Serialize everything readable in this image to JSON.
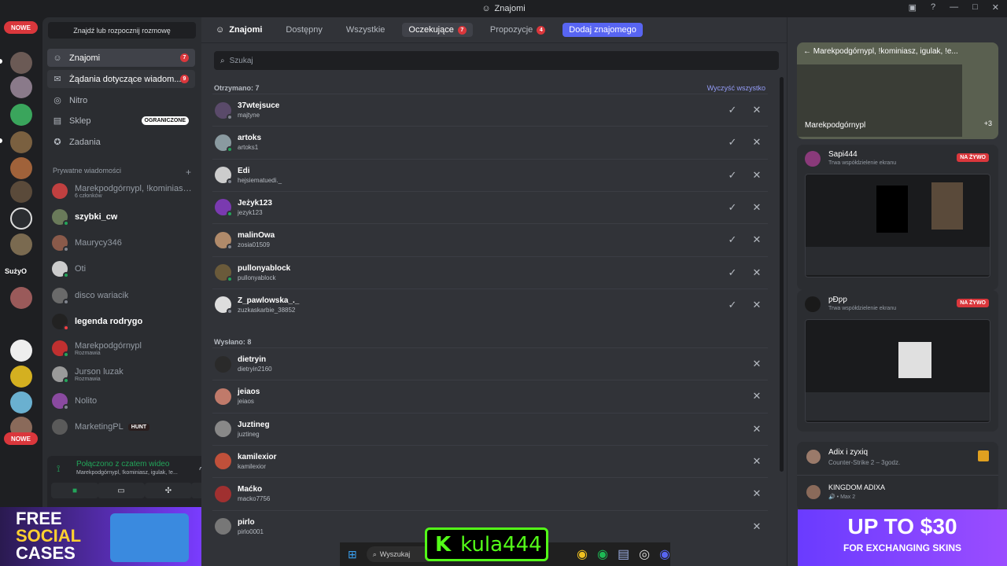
{
  "window": {
    "title": "Znajomi"
  },
  "guilds": {
    "new_label": "NOWE",
    "server_text": "SużyO"
  },
  "sidebar": {
    "find_button": "Znajdź lub rozpocznij rozmowę",
    "nav": [
      {
        "label": "Znajomi",
        "badge": "7"
      },
      {
        "label": "Żądania dotyczące wiadom...",
        "badge": "9"
      },
      {
        "label": "Nitro"
      },
      {
        "label": "Sklep",
        "badge": "OGRANICZONE"
      },
      {
        "label": "Zadania"
      }
    ],
    "dm_header": "Prywatne wiadomości",
    "dms": [
      {
        "name": "Marekpodgórnypl, !kominiasz, i...",
        "sub": "6 członków"
      },
      {
        "name": "szybki_cw"
      },
      {
        "name": "Maurycy346"
      },
      {
        "name": "Oti"
      },
      {
        "name": "disco wariacik"
      },
      {
        "name": "legenda rodrygo"
      },
      {
        "name": "Marekpodgórnypl",
        "sub": "Rozmawia"
      },
      {
        "name": "Jurson luzak",
        "sub": "Rozmawia"
      },
      {
        "name": "Nolito"
      },
      {
        "name": "MarketingPL",
        "tag": "HUNT"
      }
    ],
    "voice": {
      "title": "Połączono z czatem wideo",
      "sub": "Marekpodgórnypl, !kominiasz, igulak, !e..."
    }
  },
  "main": {
    "title": "Znajomi",
    "tabs": [
      {
        "label": "Dostępny"
      },
      {
        "label": "Wszystkie"
      },
      {
        "label": "Oczekujące",
        "count": "7"
      },
      {
        "label": "Propozycje",
        "count": "4"
      }
    ],
    "add_friend": "Dodaj znajomego",
    "search_placeholder": "Szukaj",
    "received_header": "Otrzymano: 7",
    "clear_all": "Wyczyść wszystko",
    "received": [
      {
        "name": "37wtejsuce",
        "user": "majtyne"
      },
      {
        "name": "artoks",
        "user": "artoks1"
      },
      {
        "name": "Edi",
        "user": "hejsiematuedi._"
      },
      {
        "name": "Jeżyk123",
        "user": "jezyk123"
      },
      {
        "name": "malinOwa",
        "user": "zosia01509"
      },
      {
        "name": "pullonyablock",
        "user": "pullonyablock"
      },
      {
        "name": "Z_pawlowska_._",
        "user": "zuzkaskarbie_38852"
      }
    ],
    "sent_header": "Wysłano: 8",
    "sent": [
      {
        "name": "dietryin",
        "user": "dietryin2160"
      },
      {
        "name": "jeiaos",
        "user": "jeiaos"
      },
      {
        "name": "Juztineg",
        "user": "juztineg"
      },
      {
        "name": "kamilexior",
        "user": "kamilexior"
      },
      {
        "name": "Maćko",
        "user": "macko7756"
      },
      {
        "name": "pirlo",
        "user": "pirlo0001"
      }
    ]
  },
  "right": {
    "call_title": "Marekpodgórnypl, !kominiasz, igulak, !e...",
    "call_user": "Marekpodgórnypl",
    "call_more": "+3",
    "streams": [
      {
        "user": "Sapi444",
        "status": "Trwa współdzielenie ekranu",
        "badge": "NA ŻYWO"
      },
      {
        "user": "ƿƉƿƿ",
        "status": "Trwa współdzielenie ekranu",
        "badge": "NA ŻYWO"
      }
    ],
    "activities": [
      {
        "title": "Adix i zyxiq",
        "sub": "Counter-Strike 2 – 3godz."
      },
      {
        "title": "KINGDOM ADIXA",
        "sub": "Max 2"
      }
    ]
  },
  "overlays": {
    "ad_left_line1": "FREE",
    "ad_left_line2": "SOCIAL",
    "ad_left_line3": "CASES",
    "ad_right_line1": "UP TO $30",
    "ad_right_line2": "FOR EXCHANGING SKINS",
    "kula": "kula444",
    "taskbar_search": "Wyszukaj"
  }
}
